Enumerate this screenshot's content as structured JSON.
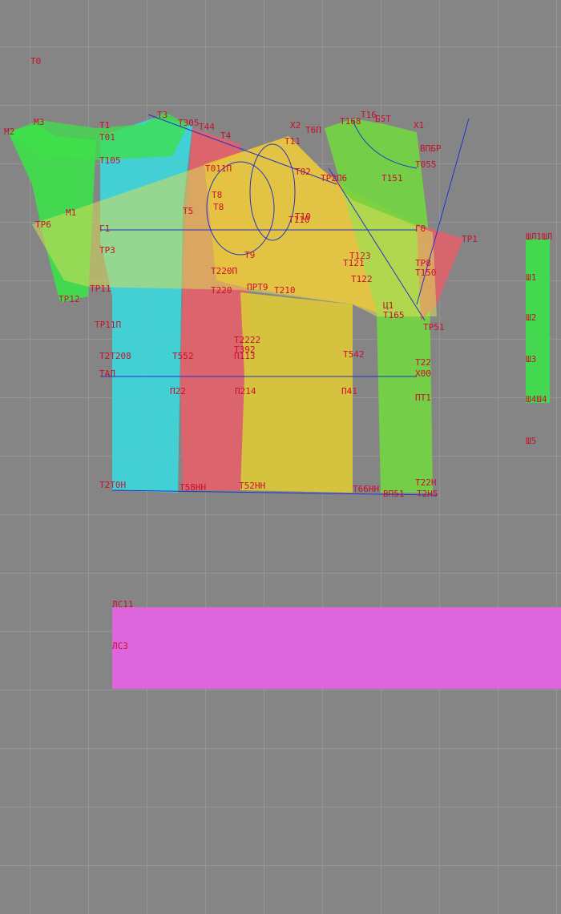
{
  "colors": {
    "background": "#858585",
    "grid": "#a3a3a3",
    "cyan_piece": "#3fd4d8",
    "red_piece": "#e0626a",
    "orange_piece": "#f5a623",
    "yellow_piece": "#d9c53a",
    "green_piece": "#72d640",
    "bright_green_piece": "#3de04a",
    "sleeve_overlay": "#d8dc5a",
    "magenta_strip": "#dd66dd",
    "lines": "#2233cc",
    "labels": "#c8102e"
  },
  "labels": {
    "t0": "Т0",
    "m2": "М2",
    "m3": "М3",
    "t3": "Т3",
    "t1": "Т1",
    "t01": "Т01",
    "t305": "Т305",
    "t44": "Т44",
    "t4": "Т4",
    "x2": "Х2",
    "t6p": "Т6П",
    "t16": "Т16",
    "t168": "Т168",
    "t56t": "Б5Т",
    "x1": "Х1",
    "vpbr": "ВПБР",
    "t105": "Т105",
    "t011p": "Т011П",
    "t11": "Т11",
    "t02": "Т02",
    "tr2p6": "ТР2П6",
    "t151": "Т151",
    "t055": "Т055",
    "m1": "М1",
    "t8a": "Т8",
    "t8b": "Т8",
    "t5": "Т5",
    "t10": "Т10",
    "t110": "Т110",
    "tr6": "ТР6",
    "g1": "Г1",
    "g0": "Г0",
    "tr1": "ТР1",
    "tr3": "ТР3",
    "t9": "Т9",
    "t123": "Т123",
    "t121": "Т121",
    "t122": "Т122",
    "tr8": "ТР8",
    "t150": "Т150",
    "t220p": "Т220П",
    "t220": "Т220",
    "prt9": "ПРТ9",
    "t210": "Т210",
    "tr11": "ТР11",
    "tr12": "ТР12",
    "u1": "Ц1",
    "t165": "Т165",
    "tr51": "ТР51",
    "tr11p": "ТР11П",
    "t222": "Т2222",
    "t392": "Т392",
    "t113": "П113",
    "t208": "Т2Т208",
    "t552": "Т552",
    "t542": "Т542",
    "t22": "Т22",
    "tal": "ТАЛ",
    "x00": "Х00",
    "p22": "П22",
    "p214": "П214",
    "p41": "П41",
    "pt1": "ПТ1",
    "t20h": "Т2Т0Н",
    "t58h": "Т58НН",
    "t52h": "Т52НН",
    "t66h": "Т66НН",
    "t22h": "Т22Н",
    "vp51": "ВП51",
    "t2h5": "Т2Н5",
    "shl": "ШЛ1ШЛ",
    "sh1": "Ш1",
    "sh2": "Ш2",
    "sh3": "Ш3",
    "sh4": "Ш4Ш4",
    "sh5": "Ш5",
    "ls11": "ЛС11",
    "ls3": "ЛС3"
  }
}
